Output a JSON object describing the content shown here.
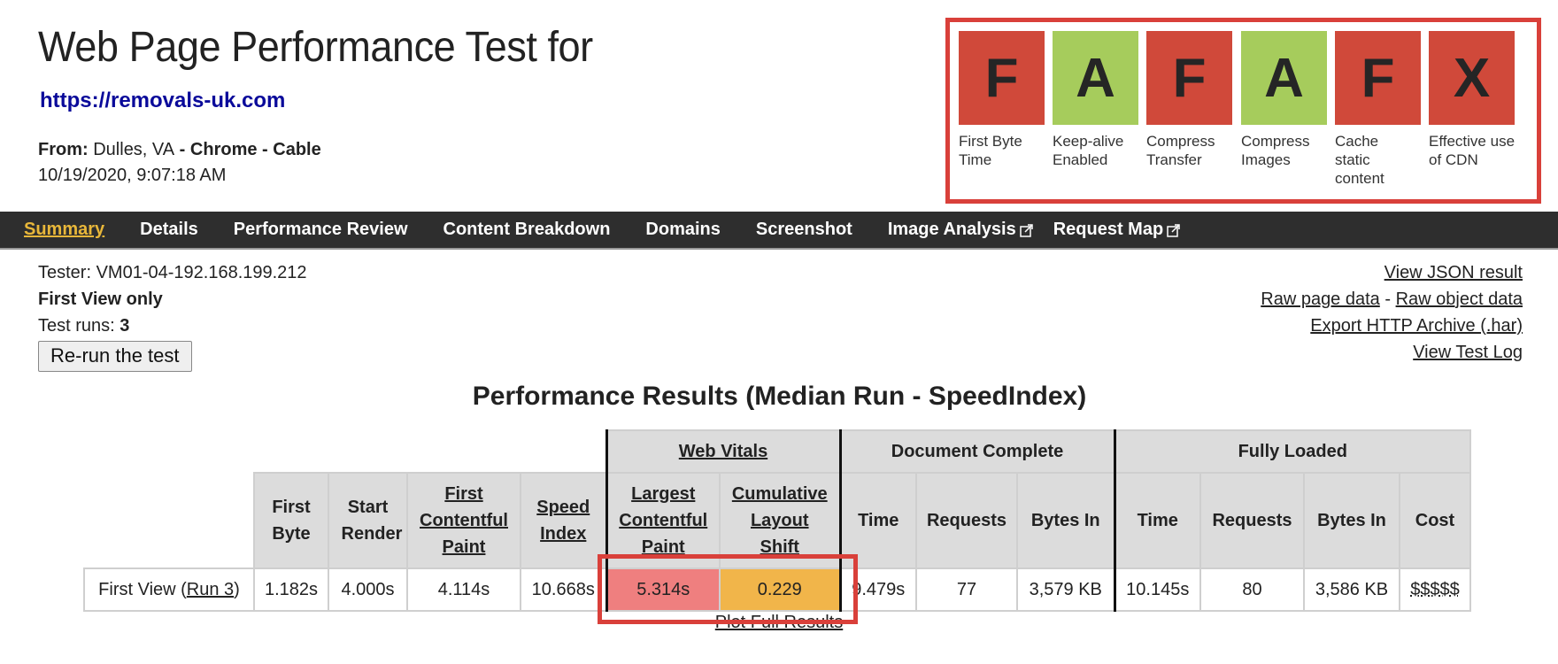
{
  "header": {
    "title": "Web Page Performance Test for",
    "url": "https://removals-uk.com",
    "from_label": "From:",
    "location": "Dulles, VA",
    "browser": "Chrome",
    "connection": "Cable",
    "separator": " - ",
    "datetime": "10/19/2020, 9:07:18 AM"
  },
  "grades": [
    {
      "letter": "F",
      "label": "First Byte Time",
      "color": "#d0493a"
    },
    {
      "letter": "A",
      "label": "Keep-alive Enabled",
      "color": "#a6cc5c"
    },
    {
      "letter": "F",
      "label": "Compress Transfer",
      "color": "#d0493a"
    },
    {
      "letter": "A",
      "label": "Compress Images",
      "color": "#a6cc5c"
    },
    {
      "letter": "F",
      "label": "Cache static content",
      "color": "#d0493a"
    },
    {
      "letter": "X",
      "label": "Effective use of CDN",
      "color": "#d0493a"
    }
  ],
  "nav": {
    "items": [
      {
        "label": "Summary",
        "active": true,
        "external": false
      },
      {
        "label": "Details",
        "active": false,
        "external": false
      },
      {
        "label": "Performance Review",
        "active": false,
        "external": false
      },
      {
        "label": "Content Breakdown",
        "active": false,
        "external": false
      },
      {
        "label": "Domains",
        "active": false,
        "external": false
      },
      {
        "label": "Screenshot",
        "active": false,
        "external": false
      },
      {
        "label": "Image Analysis",
        "active": false,
        "external": true,
        "icon": "external-link-icon"
      },
      {
        "label": "Request Map",
        "active": false,
        "external": true,
        "icon": "external-link-icon"
      }
    ],
    "active_color": "#e8b73a",
    "background": "#2e2e2e"
  },
  "info": {
    "tester_label": "Tester:",
    "tester": "VM01-04-192.168.199.212",
    "view_mode": "First View only",
    "runs_label": "Test runs:",
    "runs": "3",
    "rerun_button": "Re-run the test"
  },
  "links": {
    "view_json": "View JSON result",
    "raw_page": "Raw page data",
    "link_sep": " - ",
    "raw_object": "Raw object data",
    "export_har": "Export HTTP Archive (.har)",
    "test_log": "View Test Log"
  },
  "results": {
    "title": "Performance Results (Median Run - SpeedIndex)",
    "groups": {
      "web_vitals": "Web Vitals",
      "document_complete": "Document Complete",
      "fully_loaded": "Fully Loaded"
    },
    "columns": {
      "first_byte": "First Byte",
      "start_render": "Start Render",
      "fcp": "First Contentful Paint",
      "speed_index": "Speed Index",
      "lcp": "Largest Contentful Paint",
      "cls": "Cumulative Layout Shift",
      "doc_time": "Time",
      "doc_requests": "Requests",
      "doc_bytes": "Bytes In",
      "full_time": "Time",
      "full_requests": "Requests",
      "full_bytes": "Bytes In",
      "cost": "Cost"
    },
    "row": {
      "label_prefix": "First View (",
      "run_link": "Run 3",
      "label_suffix": ")",
      "first_byte": "1.182s",
      "start_render": "4.000s",
      "fcp": "4.114s",
      "speed_index": "10.668s",
      "lcp": "5.314s",
      "cls": "0.229",
      "doc_time": "9.479s",
      "doc_requests": "77",
      "doc_bytes": "3,579 KB",
      "full_time": "10.145s",
      "full_requests": "80",
      "full_bytes": "3,586 KB",
      "cost": "$$$$$"
    },
    "lcp_color": "#ef7f7f",
    "cls_color": "#f1b54a",
    "plot_link": "Plot Full Results"
  },
  "annotation_color": "#d9403a"
}
